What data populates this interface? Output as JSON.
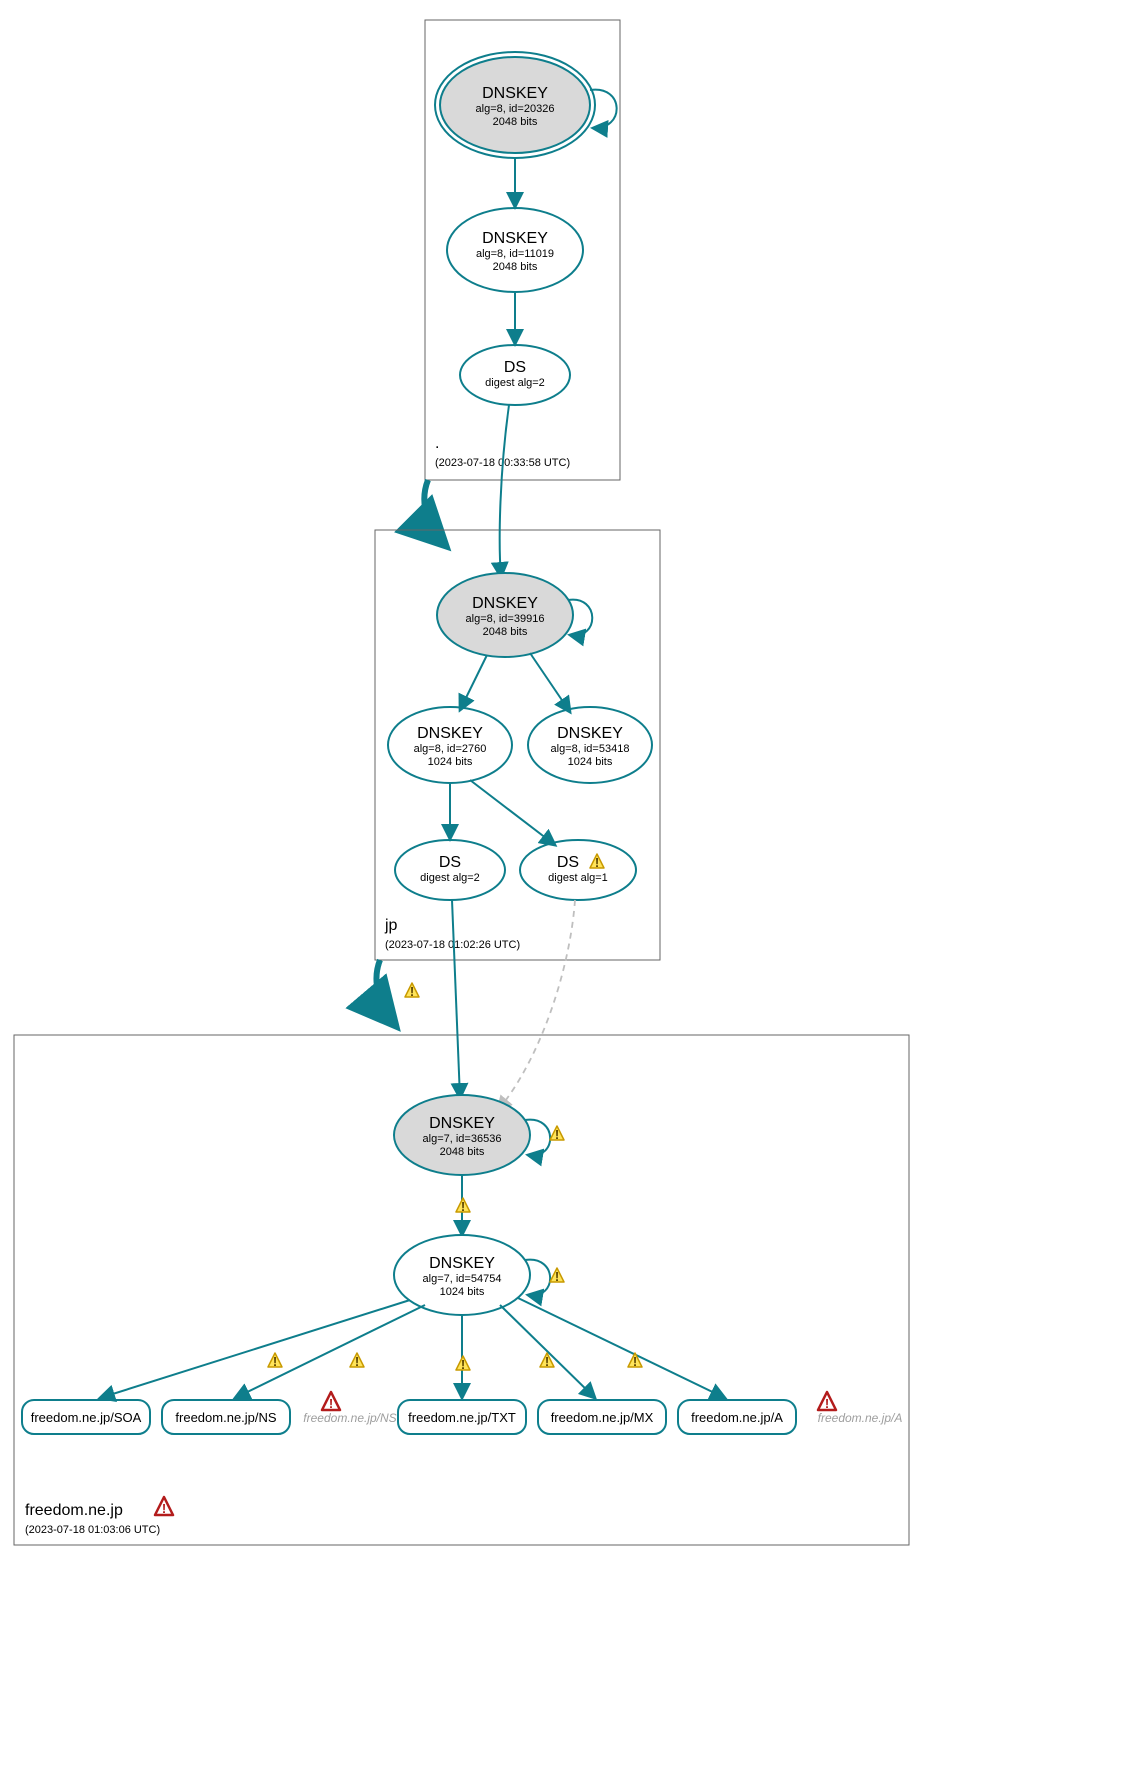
{
  "zones": {
    "root": {
      "label": ".",
      "timestamp": "(2023-07-18 00:33:58 UTC)"
    },
    "jp": {
      "label": "jp",
      "timestamp": "(2023-07-18 01:02:26 UTC)"
    },
    "domain": {
      "label": "freedom.ne.jp",
      "timestamp": "(2023-07-18 01:03:06 UTC)"
    }
  },
  "nodes": {
    "root_ksk": {
      "title": "DNSKEY",
      "line2": "alg=8, id=20326",
      "line3": "2048 bits"
    },
    "root_zsk": {
      "title": "DNSKEY",
      "line2": "alg=8, id=11019",
      "line3": "2048 bits"
    },
    "root_ds": {
      "title": "DS",
      "line2": "digest alg=2"
    },
    "jp_ksk": {
      "title": "DNSKEY",
      "line2": "alg=8, id=39916",
      "line3": "2048 bits"
    },
    "jp_zsk1": {
      "title": "DNSKEY",
      "line2": "alg=8, id=2760",
      "line3": "1024 bits"
    },
    "jp_zsk2": {
      "title": "DNSKEY",
      "line2": "alg=8, id=53418",
      "line3": "1024 bits"
    },
    "jp_ds2": {
      "title": "DS",
      "line2": "digest alg=2"
    },
    "jp_ds1": {
      "title": "DS",
      "line2": "digest alg=1"
    },
    "dom_ksk": {
      "title": "DNSKEY",
      "line2": "alg=7, id=36536",
      "line3": "2048 bits"
    },
    "dom_zsk": {
      "title": "DNSKEY",
      "line2": "alg=7, id=54754",
      "line3": "1024 bits"
    }
  },
  "rrsets": {
    "soa": "freedom.ne.jp/SOA",
    "ns": "freedom.ne.jp/NS",
    "ns_insecure": "freedom.ne.jp/NS",
    "txt": "freedom.ne.jp/TXT",
    "mx": "freedom.ne.jp/MX",
    "a": "freedom.ne.jp/A",
    "a_insecure": "freedom.ne.jp/A"
  }
}
